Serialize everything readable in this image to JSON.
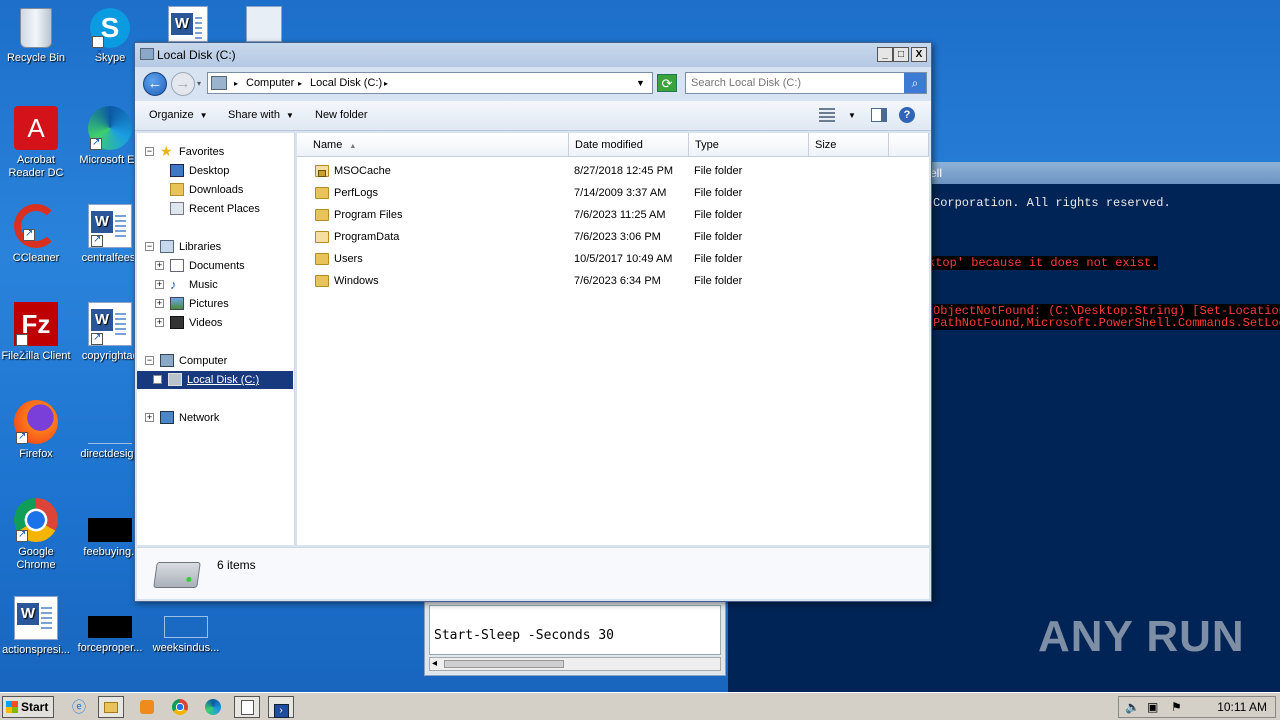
{
  "desktop": {
    "icons": [
      {
        "label": "Recycle Bin"
      },
      {
        "label": "Skype"
      },
      {
        "label": "Acrobat Reader DC"
      },
      {
        "label": "Microsoft Ed"
      },
      {
        "label": "CCleaner"
      },
      {
        "label": "centralfees."
      },
      {
        "label": "FileZilla Client"
      },
      {
        "label": "copyrightac"
      },
      {
        "label": "Firefox"
      },
      {
        "label": "directdesign"
      },
      {
        "label": "Google Chrome"
      },
      {
        "label": "feebuying.j"
      },
      {
        "label": "actionspresi..."
      },
      {
        "label": "forceproper..."
      },
      {
        "label": "weeksindus..."
      }
    ]
  },
  "powershell": {
    "title": "ell",
    "lines": [
      "Corporation. All rights reserved.",
      "ktop' because it does not exist.",
      " ObjectNotFound: (C:\\Desktop:String) [Set-Location",
      " PathNotFound,Microsoft.PowerShell.Commands.SetLoc"
    ]
  },
  "notepad": {
    "text": "Start-Sleep -Seconds 30"
  },
  "explorer": {
    "title": "Local Disk (C:)",
    "window_buttons": {
      "minimize": "_",
      "maximize": "□",
      "close": "X"
    },
    "address": {
      "computer": "Computer",
      "drive": "Local Disk (C:)"
    },
    "search_placeholder": "Search Local Disk (C:)",
    "toolbar": {
      "organize": "Organize",
      "share": "Share with",
      "new_folder": "New folder"
    },
    "nav": {
      "favorites": "Favorites",
      "desktop": "Desktop",
      "downloads": "Downloads",
      "recent": "Recent Places",
      "libraries": "Libraries",
      "documents": "Documents",
      "music": "Music",
      "pictures": "Pictures",
      "videos": "Videos",
      "computer": "Computer",
      "local_disk": "Local Disk (C:)",
      "network": "Network"
    },
    "columns": {
      "name": "Name",
      "date": "Date modified",
      "type": "Type",
      "size": "Size"
    },
    "files": [
      {
        "name": "MSOCache",
        "date": "8/27/2018 12:45 PM",
        "type": "File folder"
      },
      {
        "name": "PerfLogs",
        "date": "7/14/2009 3:37 AM",
        "type": "File folder"
      },
      {
        "name": "Program Files",
        "date": "7/6/2023 11:25 AM",
        "type": "File folder"
      },
      {
        "name": "ProgramData",
        "date": "7/6/2023 3:06 PM",
        "type": "File folder"
      },
      {
        "name": "Users",
        "date": "10/5/2017 10:49 AM",
        "type": "File folder"
      },
      {
        "name": "Windows",
        "date": "7/6/2023 6:34 PM",
        "type": "File folder"
      }
    ],
    "status_count": "6 items"
  },
  "taskbar": {
    "start": "Start",
    "clock": "10:11 AM"
  },
  "watermark": "ANY RUN"
}
